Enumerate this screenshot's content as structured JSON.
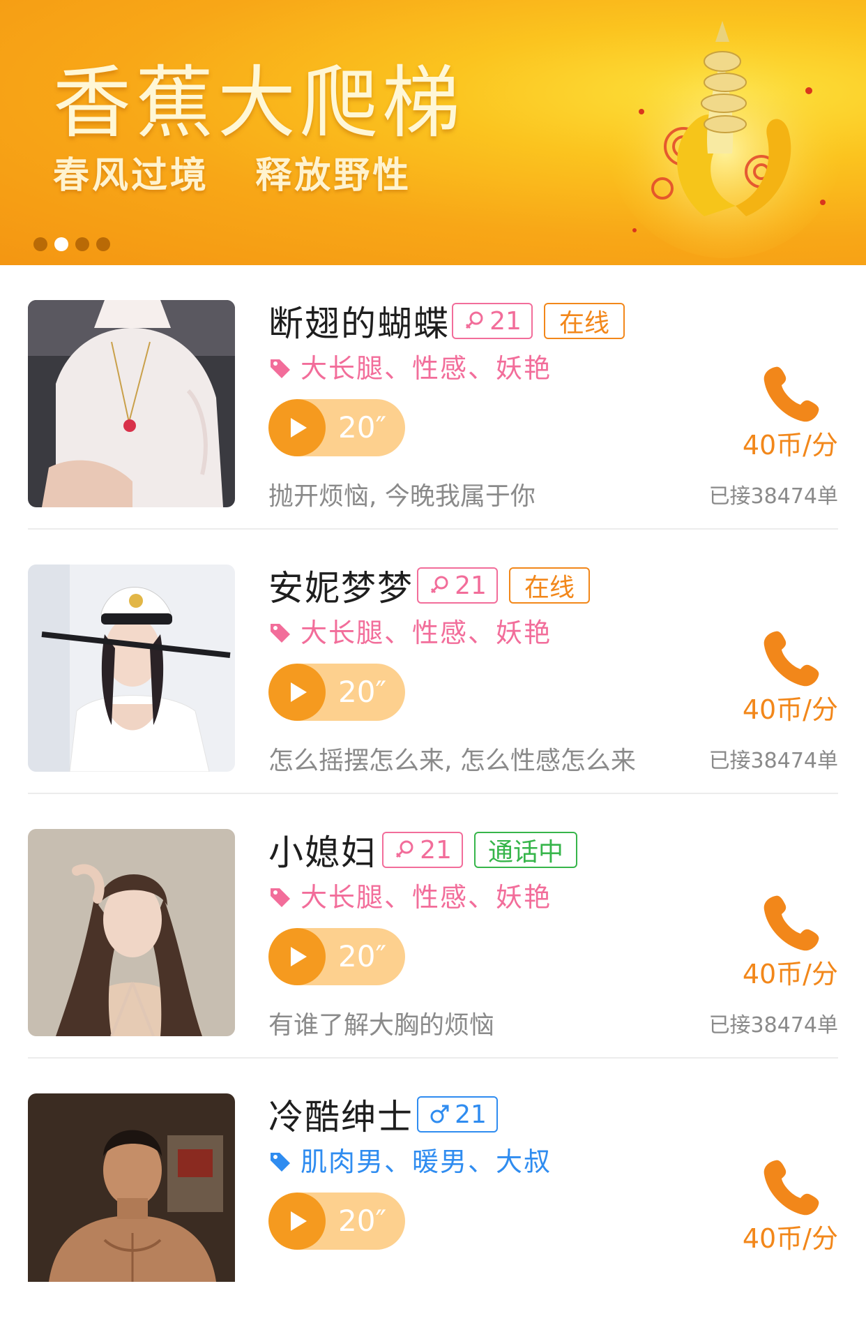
{
  "banner": {
    "title": "香蕉大爬梯",
    "subtitle": "春风过境   释放野性",
    "pages": 4,
    "active_page": 2
  },
  "colors": {
    "accent_orange": "#f2871a",
    "female_pink": "#f26d9a",
    "male_blue": "#2f8cf0",
    "calling_green": "#36b54a"
  },
  "users": [
    {
      "name": "断翅的蝴蝶",
      "gender": "female",
      "gender_icon": "female-icon",
      "age": "21",
      "status": "在线",
      "tags": "大长腿、性感、妖艳",
      "voice_duration": "20″",
      "intro": "抛开烦恼, 今晚我属于你",
      "price": "40币/分",
      "orders": "已接38474单"
    },
    {
      "name": "安妮梦梦",
      "gender": "female",
      "gender_icon": "female-icon",
      "age": "21",
      "status": "在线",
      "tags": "大长腿、性感、妖艳",
      "voice_duration": "20″",
      "intro": "怎么摇摆怎么来, 怎么性感怎么来",
      "price": "40币/分",
      "orders": "已接38474单"
    },
    {
      "name": "小媳妇",
      "gender": "female",
      "gender_icon": "female-icon",
      "age": "21",
      "status": "通话中",
      "tags": "大长腿、性感、妖艳",
      "voice_duration": "20″",
      "intro": "有谁了解大胸的烦恼",
      "price": "40币/分",
      "orders": "已接38474单"
    },
    {
      "name": "冷酷绅士",
      "gender": "male",
      "gender_icon": "male-icon",
      "age": "21",
      "status": "",
      "tags": "肌肉男、暖男、大叔",
      "voice_duration": "20″",
      "intro": "",
      "price": "40币/分",
      "orders": ""
    }
  ]
}
